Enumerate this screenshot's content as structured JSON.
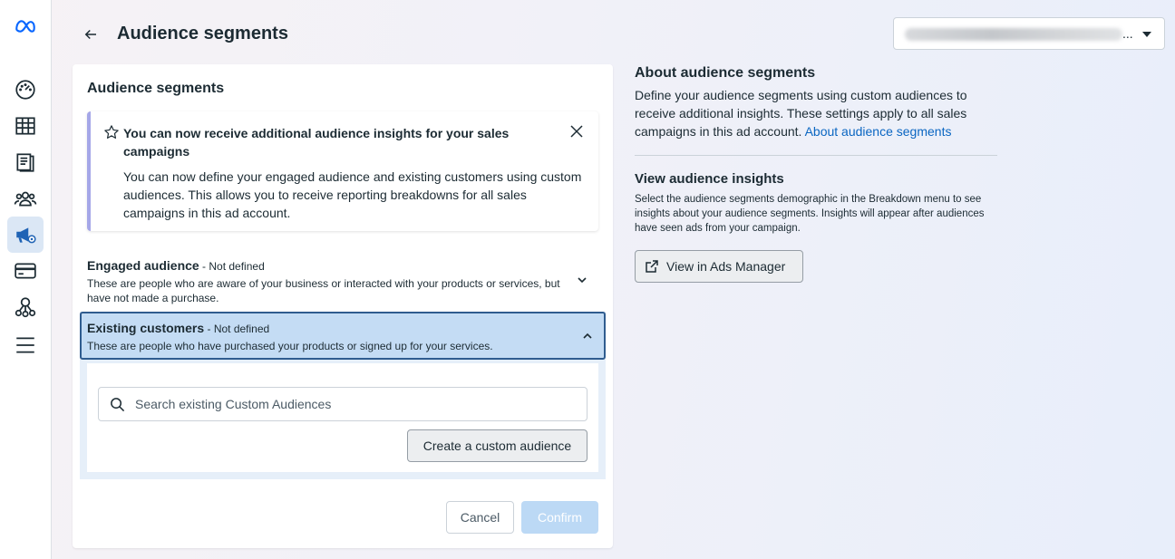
{
  "header": {
    "title": "Audience segments",
    "account_suffix": "..."
  },
  "sidebar": {
    "items": [
      {
        "icon": "meta-logo-icon"
      },
      {
        "icon": "dashboard-gauge-icon"
      },
      {
        "icon": "table-grid-icon"
      },
      {
        "icon": "pages-icon"
      },
      {
        "icon": "people-icon"
      },
      {
        "icon": "ads-megaphone-icon",
        "active": true
      },
      {
        "icon": "billing-card-icon"
      },
      {
        "icon": "business-network-icon"
      },
      {
        "icon": "menu-icon"
      }
    ]
  },
  "card": {
    "title": "Audience segments",
    "notice": {
      "title": "You can now receive additional audience insights for your sales campaigns",
      "body": "You can now define your engaged audience and existing customers using custom audiences. This allows you to receive reporting breakdowns for all sales campaigns in this ad account."
    },
    "engaged": {
      "title": "Engaged audience",
      "status": " - Not defined",
      "desc": "These are people who are aware of your business or interacted with your products or services, but have not made a purchase."
    },
    "existing": {
      "title": "Existing customers",
      "status": " - Not defined",
      "desc": "These are people who have purchased your products or signed up for your services.",
      "search_placeholder": "Search existing Custom Audiences",
      "create_label": "Create a custom audience"
    },
    "cancel_label": "Cancel",
    "confirm_label": "Confirm"
  },
  "about": {
    "title": "About audience segments",
    "body": "Define your audience segments using custom audiences to receive additional insights. These settings apply to all sales campaigns in this ad account.",
    "link": "About audience segments"
  },
  "view_insights": {
    "title": "View audience insights",
    "body": "Select the audience segments demographic in the Breakdown menu to see insights about your audience segments. Insights will appear after audiences have seen ads from your campaign.",
    "button_label": "View in Ads Manager"
  },
  "colors": {
    "accent": "#0a66c2",
    "selected_bg": "#c4dcf4",
    "selected_border": "#2f5c8f",
    "notice_border": "#a5a7e8",
    "confirm_disabled": "#bcd9f5"
  }
}
